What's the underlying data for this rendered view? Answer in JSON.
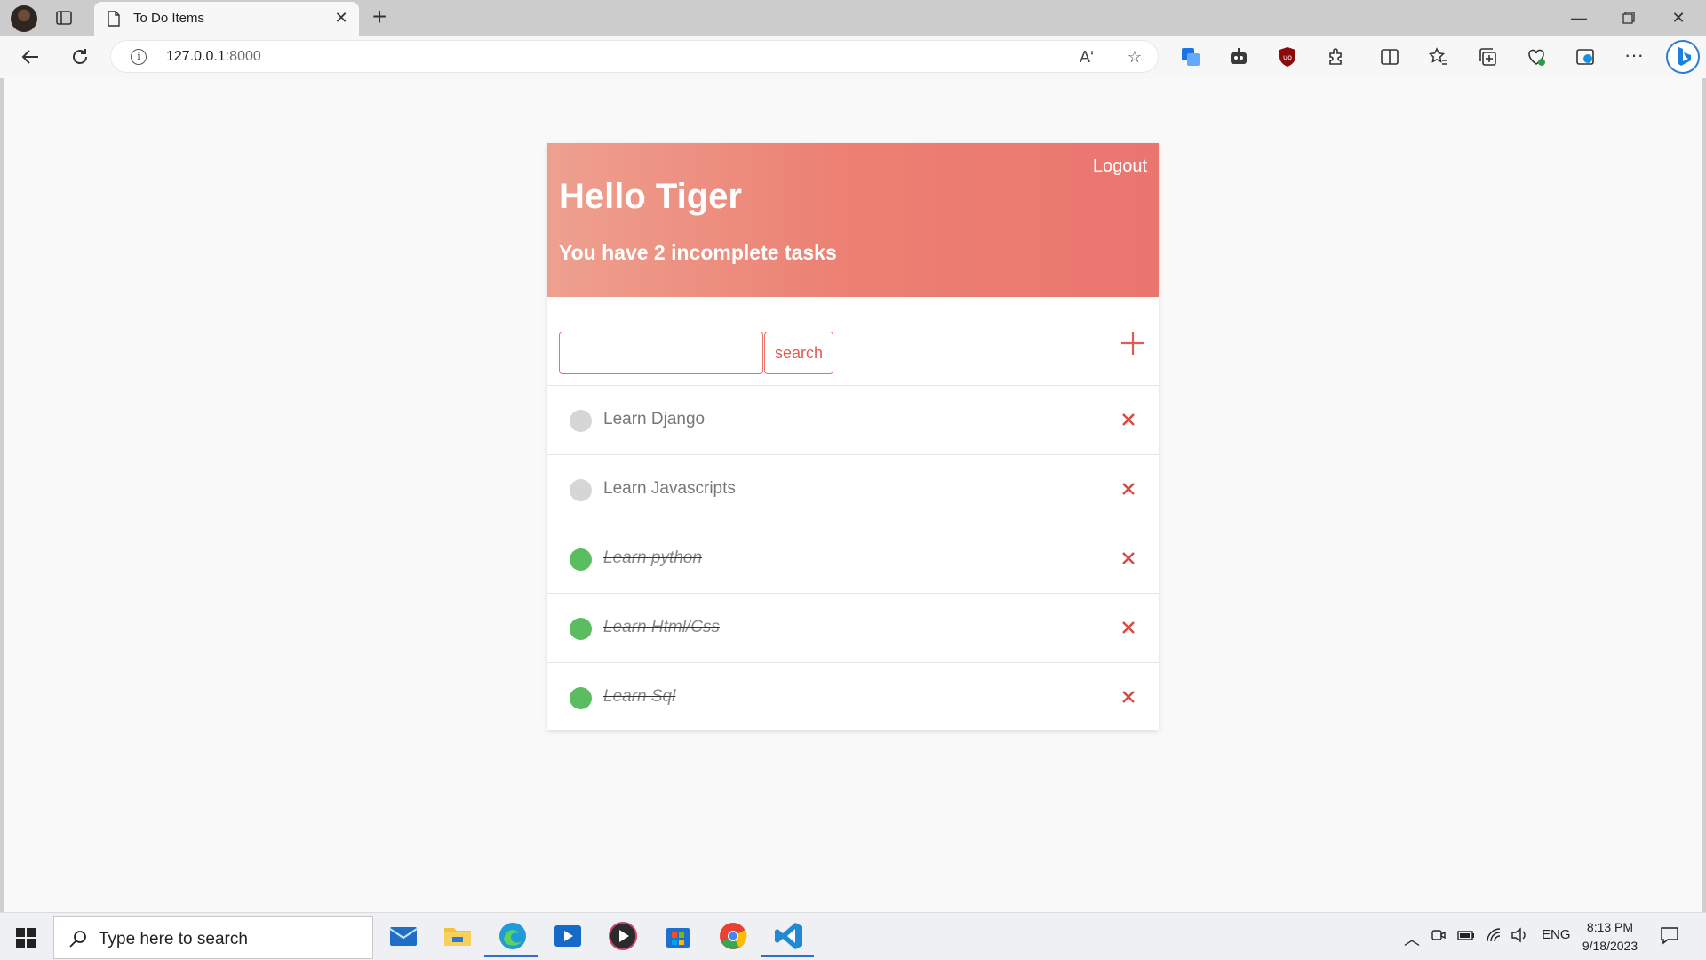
{
  "browser": {
    "tab_title": "To Do Items",
    "url_host": "127.0.0.1",
    "url_port": ":8000"
  },
  "page": {
    "logout_label": "Logout",
    "greeting": "Hello Tiger",
    "subtitle": "You have 2 incomplete tasks",
    "search_value": "",
    "search_button_label": "search",
    "items": [
      {
        "title": "Learn Django",
        "complete": false
      },
      {
        "title": "Learn Javascripts",
        "complete": false
      },
      {
        "title": "Learn python",
        "complete": true
      },
      {
        "title": "Learn Html/Css",
        "complete": true
      },
      {
        "title": "Learn Sql",
        "complete": true
      }
    ],
    "colors": {
      "accent": "#e9716a",
      "incomplete_dot": "#d6d6d6",
      "complete_dot": "#5cbc62",
      "delete_icon": "#d64a43"
    }
  },
  "taskbar": {
    "search_placeholder": "Type here to search",
    "language": "ENG",
    "time": "8:13 PM",
    "date": "9/18/2023"
  }
}
